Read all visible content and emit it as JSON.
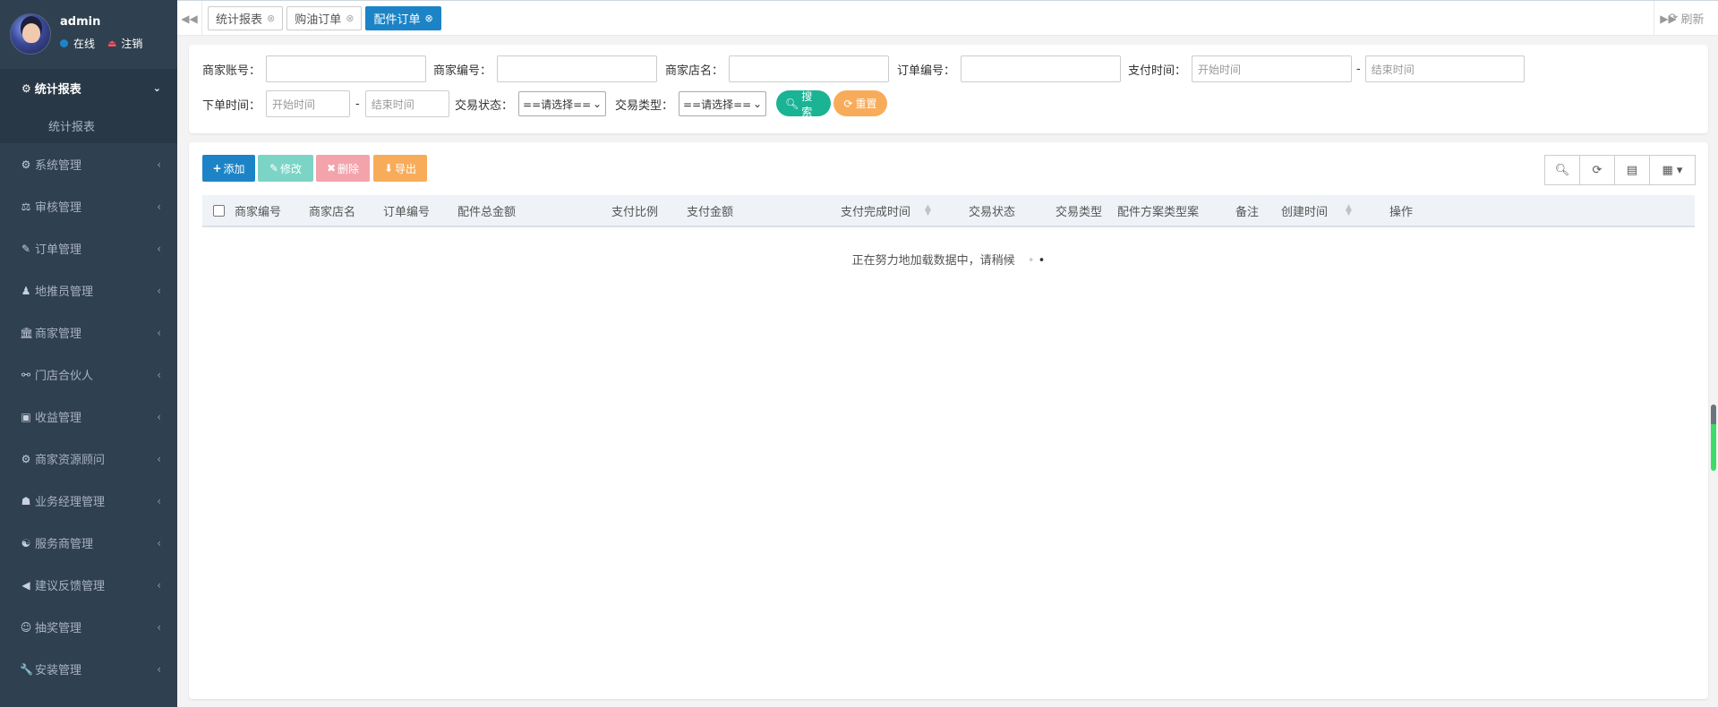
{
  "sidebar": {
    "user": {
      "name": "admin",
      "status": "在线",
      "logout": "注销"
    },
    "active_menu": {
      "label": "统计报表",
      "sub": "统计报表"
    },
    "items": [
      {
        "label": "系统管理",
        "icon": "⚙"
      },
      {
        "label": "审核管理",
        "icon": "⚖"
      },
      {
        "label": "订单管理",
        "icon": "✎"
      },
      {
        "label": "地推员管理",
        "icon": "♟"
      },
      {
        "label": "商家管理",
        "icon": "🏛"
      },
      {
        "label": "门店合伙人",
        "icon": "⚯"
      },
      {
        "label": "收益管理",
        "icon": "▣"
      },
      {
        "label": "商家资源顾问",
        "icon": "⚙"
      },
      {
        "label": "业务经理管理",
        "icon": "☗"
      },
      {
        "label": "服务商管理",
        "icon": "☯"
      },
      {
        "label": "建议反馈管理",
        "icon": "◀"
      },
      {
        "label": "抽奖管理",
        "icon": "☺"
      },
      {
        "label": "安装管理",
        "icon": "🔧"
      }
    ]
  },
  "tabs": [
    {
      "label": "统计报表",
      "active": false
    },
    {
      "label": "购油订单",
      "active": false
    },
    {
      "label": "配件订单",
      "active": true
    }
  ],
  "refresh_label": "刷新",
  "search": {
    "merchant_account": {
      "label": "商家账号：",
      "value": ""
    },
    "merchant_no": {
      "label": "商家编号：",
      "value": ""
    },
    "shop_name": {
      "label": "商家店名：",
      "value": ""
    },
    "order_no": {
      "label": "订单编号：",
      "value": ""
    },
    "pay_time": {
      "label": "支付时间：",
      "start": "开始时间",
      "end": "结束时间"
    },
    "order_time": {
      "label": "下单时间：",
      "start": "开始时间",
      "end": "结束时间"
    },
    "trade_status": {
      "label": "交易状态：",
      "value": "==请选择=="
    },
    "trade_type": {
      "label": "交易类型：",
      "value": "==请选择=="
    },
    "separator": "-",
    "search_btn": "搜索",
    "reset_btn": "重置"
  },
  "toolbar": {
    "add": "添加",
    "edit": "修改",
    "delete": "删除",
    "export": "导出"
  },
  "table": {
    "columns": [
      "商家编号",
      "商家店名",
      "订单编号",
      "配件总金额",
      "支付比例",
      "支付金额",
      "支付完成时间",
      "交易状态",
      "交易类型",
      "配件方案类型案",
      "备注",
      "创建时间",
      "操作"
    ],
    "loading_text": "正在努力地加载数据中，请稍候"
  },
  "colors": {
    "primary": "#1c84c6",
    "success": "#1ab394",
    "warning": "#f8ac59",
    "danger": "#ed5565",
    "info": "#23c6c8",
    "sidebar": "#2f4050"
  }
}
